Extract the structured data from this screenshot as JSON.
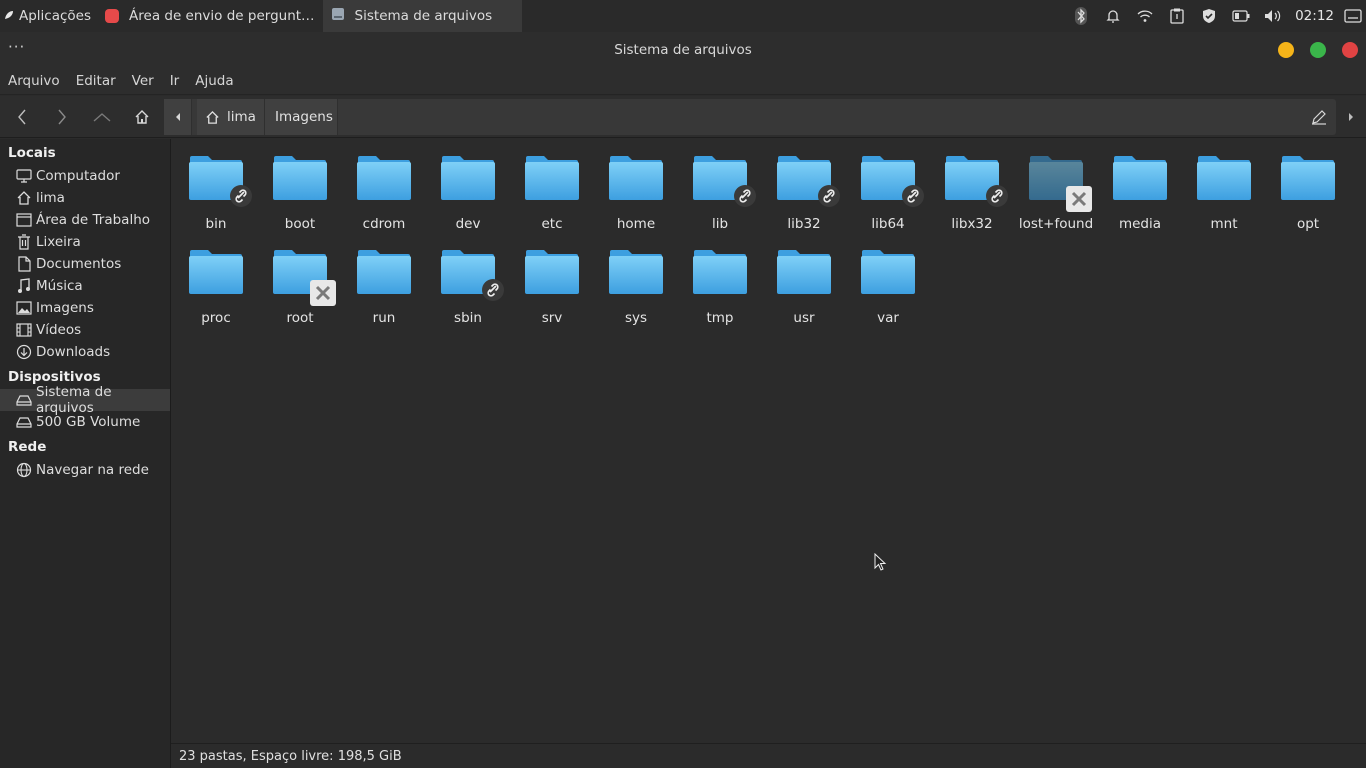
{
  "top_panel": {
    "apps_label": "Aplicações",
    "task1_label": "Área de envio de pergunt…",
    "task2_label": "Sistema de arquivos",
    "clock": "02:12",
    "icons": [
      "bluetooth-icon",
      "bell-icon",
      "wifi-icon",
      "clipboard-icon",
      "shield-icon",
      "battery-icon",
      "volume-icon",
      "display-icon"
    ]
  },
  "window": {
    "title": "Sistema de arquivos",
    "menu_dots": "···",
    "buttons": {
      "minimize": "#f5b419",
      "maximize": "#3ab54a",
      "close": "#e04343"
    }
  },
  "menubar": {
    "items": [
      "Arquivo",
      "Editar",
      "Ver",
      "Ir",
      "Ajuda"
    ]
  },
  "pathbar": {
    "crumbs": [
      "lima",
      "Imagens"
    ]
  },
  "sidebar": {
    "sections": [
      {
        "title": "Locais"
      },
      {
        "title": "Dispositivos"
      },
      {
        "title": "Rede"
      }
    ],
    "items": [
      {
        "label": "Computador",
        "icon": "computer-icon"
      },
      {
        "label": "lima",
        "icon": "home-icon"
      },
      {
        "label": "Área de Trabalho",
        "icon": "desktop-icon"
      },
      {
        "label": "Lixeira",
        "icon": "trash-icon"
      },
      {
        "label": "Documentos",
        "icon": "document-icon"
      },
      {
        "label": "Música",
        "icon": "music-icon"
      },
      {
        "label": "Imagens",
        "icon": "image-icon"
      },
      {
        "label": "Vídeos",
        "icon": "video-icon"
      },
      {
        "label": "Downloads",
        "icon": "download-icon"
      },
      {
        "label": "Sistema de arquivos",
        "icon": "drive-icon",
        "selected": true
      },
      {
        "label": "500 GB Volume",
        "icon": "drive-icon"
      },
      {
        "label": "Navegar na rede",
        "icon": "network-icon"
      }
    ]
  },
  "folders": [
    {
      "name": "bin",
      "emblem": "link"
    },
    {
      "name": "boot",
      "emblem": ""
    },
    {
      "name": "cdrom",
      "emblem": ""
    },
    {
      "name": "dev",
      "emblem": ""
    },
    {
      "name": "etc",
      "emblem": ""
    },
    {
      "name": "home",
      "emblem": ""
    },
    {
      "name": "lib",
      "emblem": "link"
    },
    {
      "name": "lib32",
      "emblem": "link"
    },
    {
      "name": "lib64",
      "emblem": "link"
    },
    {
      "name": "libx32",
      "emblem": "link"
    },
    {
      "name": "lost+found",
      "emblem": "locked"
    },
    {
      "name": "media",
      "emblem": ""
    },
    {
      "name": "mnt",
      "emblem": ""
    },
    {
      "name": "opt",
      "emblem": ""
    },
    {
      "name": "proc",
      "emblem": ""
    },
    {
      "name": "root",
      "emblem": "locked"
    },
    {
      "name": "run",
      "emblem": ""
    },
    {
      "name": "sbin",
      "emblem": "link"
    },
    {
      "name": "srv",
      "emblem": ""
    },
    {
      "name": "sys",
      "emblem": ""
    },
    {
      "name": "tmp",
      "emblem": ""
    },
    {
      "name": "usr",
      "emblem": ""
    },
    {
      "name": "var",
      "emblem": ""
    }
  ],
  "status": {
    "text": "23 pastas, Espaço livre: 198,5 GiB"
  },
  "colors": {
    "folder_light": "#7fd0f7",
    "folder_dark": "#3d9fe0",
    "panel_bg": "#2a2a2a",
    "content_bg": "#2b2b2b"
  }
}
